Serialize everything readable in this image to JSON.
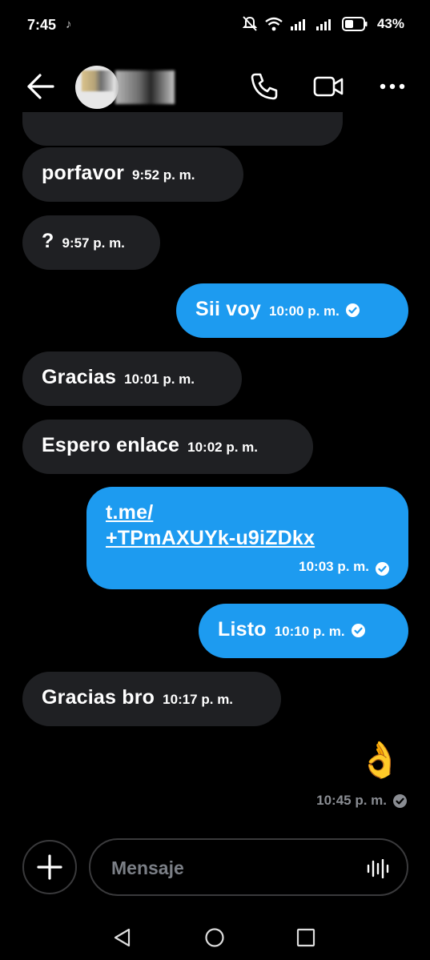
{
  "status_bar": {
    "time": "7:45",
    "battery": "43%"
  },
  "header": {
    "back_icon": "arrow-left-icon",
    "call_icon": "phone-icon",
    "video_icon": "video-icon",
    "more_icon": "more-horizontal-icon"
  },
  "messages": [
    {
      "dir": "in",
      "text": "porfavor",
      "time": "9:52 p. m."
    },
    {
      "dir": "in",
      "text": "?",
      "time": "9:57 p. m."
    },
    {
      "dir": "out",
      "text": "Sii voy",
      "time": "10:00 p. m."
    },
    {
      "dir": "in",
      "text": "Gracias",
      "time": "10:01 p. m."
    },
    {
      "dir": "in",
      "text": "Espero enlace",
      "time": "10:02 p. m."
    },
    {
      "dir": "out",
      "link_line1": "t.me/",
      "link_line2": "+TPmAXUYk-u9iZDkx",
      "time": "10:03 p. m."
    },
    {
      "dir": "out",
      "text": "Listo",
      "time": "10:10 p. m."
    },
    {
      "dir": "in",
      "text": "Gracias bro",
      "time": "10:17 p. m."
    },
    {
      "dir": "out",
      "text": "👌",
      "time": "10:45 p. m."
    }
  ],
  "composer": {
    "placeholder": "Mensaje",
    "add_icon": "plus-icon",
    "voice_icon": "voice-wave-icon"
  },
  "colors": {
    "outgoing": "#1d9bf0",
    "incoming": "#1f2023",
    "background": "#000000"
  }
}
